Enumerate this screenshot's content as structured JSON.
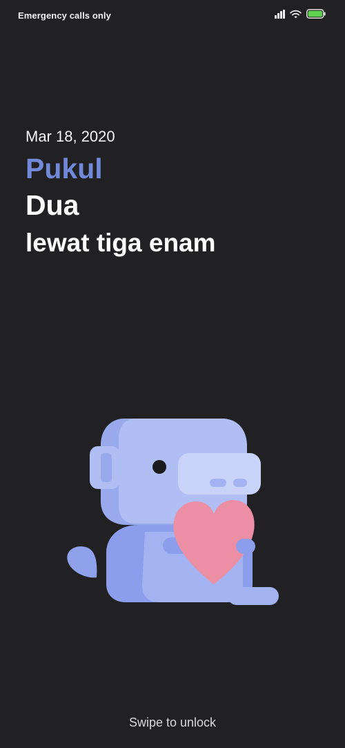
{
  "status_bar": {
    "carrier_text": "Emergency calls only",
    "icons": [
      "signal-icon",
      "wifi-icon",
      "battery-icon"
    ],
    "battery_color": "#5ed14e"
  },
  "lockscreen": {
    "date": "Mar 18, 2020",
    "time_label": "Pukul",
    "time_hour": "Dua",
    "time_minute": "lewat tiga enam",
    "accent_color": "#7289da"
  },
  "illustration": {
    "name": "wumpus-holding-heart"
  },
  "unlock_hint": "Swipe to unlock"
}
